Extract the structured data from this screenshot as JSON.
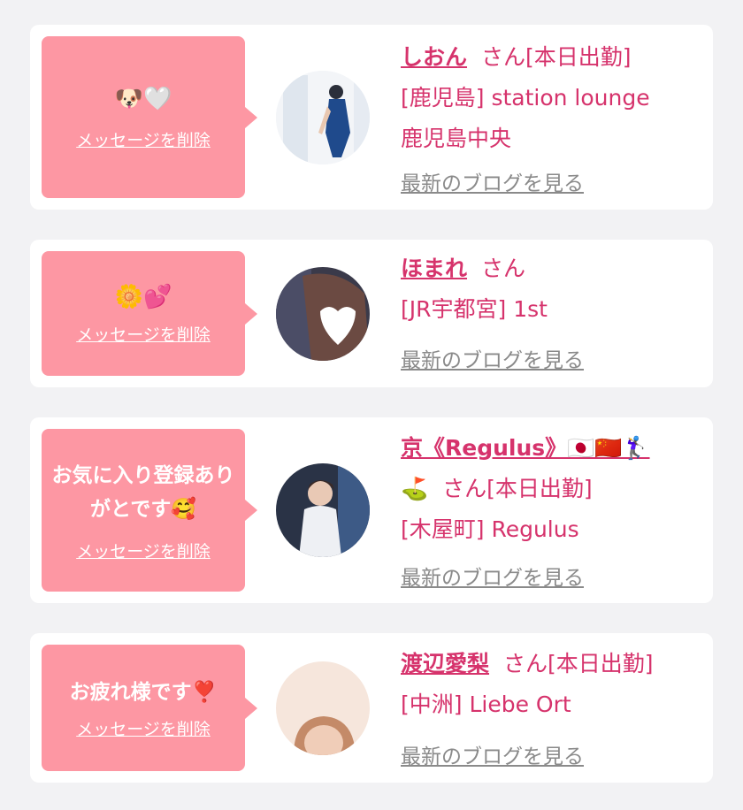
{
  "delete_label": "メッセージを削除",
  "blog_label": "最新のブログを見る",
  "colors": {
    "accent": "#d6336c",
    "bubble": "#fd97a3",
    "muted": "#8a8a8a"
  },
  "entries": [
    {
      "message": "",
      "message_emoji": "🐶🤍",
      "name": "しおん",
      "suffix": "さん[本日出勤]",
      "shop_lines": [
        "[鹿児島] station lounge",
        "鹿児島中央"
      ]
    },
    {
      "message": "",
      "message_emoji": "🌼💕",
      "name": "ほまれ",
      "suffix": "さん",
      "shop_lines": [
        "[JR宇都宮] 1st"
      ]
    },
    {
      "message": "お気に入り登録ありがとです🥰",
      "message_emoji": "",
      "name": "京《Regulus》🇯🇵🇨🇳🏌️‍♀️",
      "name_cont": "⛳",
      "suffix": "さん[本日出勤]",
      "shop_lines": [
        "[木屋町] Regulus"
      ]
    },
    {
      "message": "お疲れ様です❣️",
      "message_emoji": "",
      "name": "渡辺愛梨",
      "suffix": "さん[本日出勤]",
      "shop_lines": [
        "[中洲] Liebe Ort"
      ]
    }
  ]
}
